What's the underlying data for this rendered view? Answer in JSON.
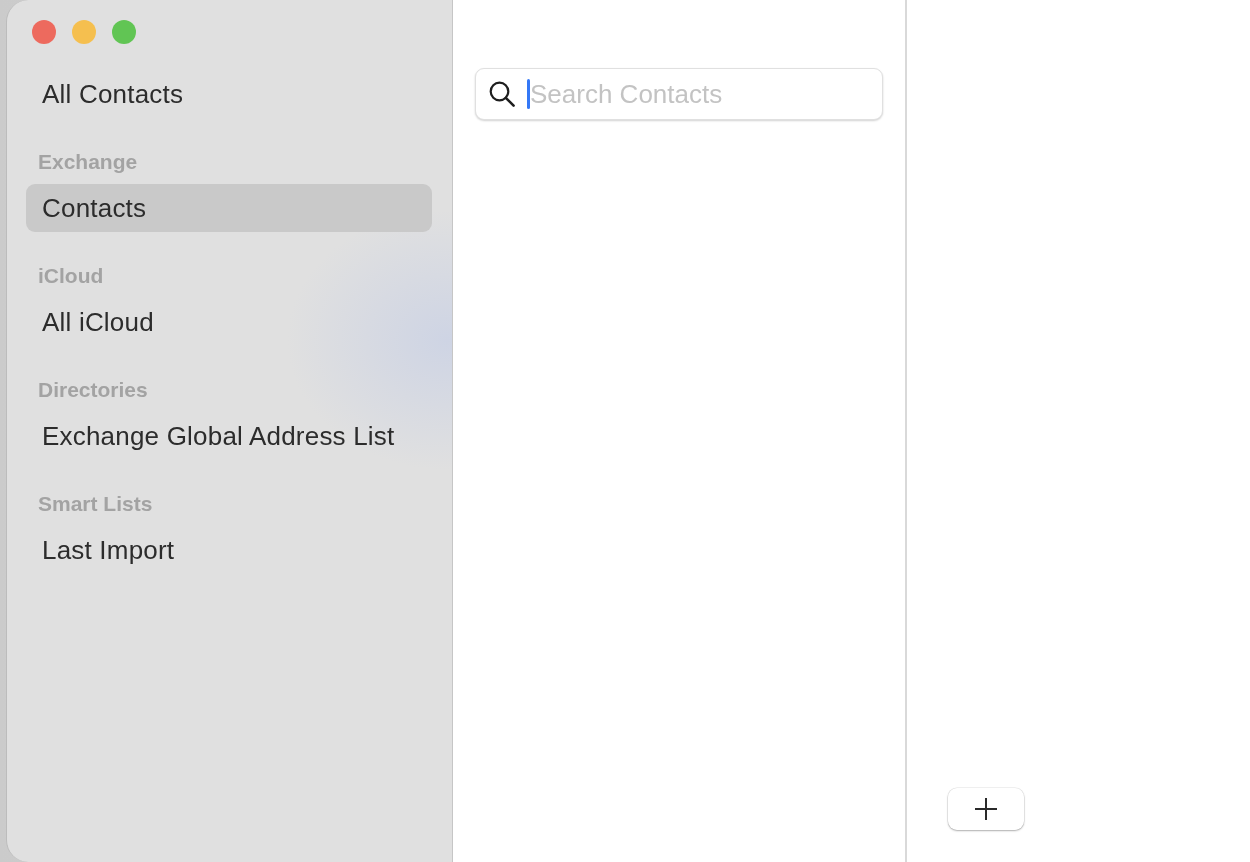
{
  "window": {
    "controls": [
      {
        "color": "#ed6a5e"
      },
      {
        "color": "#f5bf4f"
      },
      {
        "color": "#61c554"
      }
    ]
  },
  "sidebar": {
    "groups": [
      {
        "items": [
          {
            "label": "All Contacts",
            "selected": false
          }
        ]
      },
      {
        "heading": "Exchange",
        "items": [
          {
            "label": "Contacts",
            "selected": true
          }
        ]
      },
      {
        "heading": "iCloud",
        "items": [
          {
            "label": "All iCloud",
            "selected": false
          }
        ]
      },
      {
        "heading": "Directories",
        "items": [
          {
            "label": "Exchange Global Address List",
            "selected": false
          }
        ]
      },
      {
        "heading": "Smart Lists",
        "items": [
          {
            "label": "Last Import",
            "selected": false
          }
        ]
      }
    ]
  },
  "search": {
    "placeholder": "Search Contacts",
    "focused": true
  }
}
